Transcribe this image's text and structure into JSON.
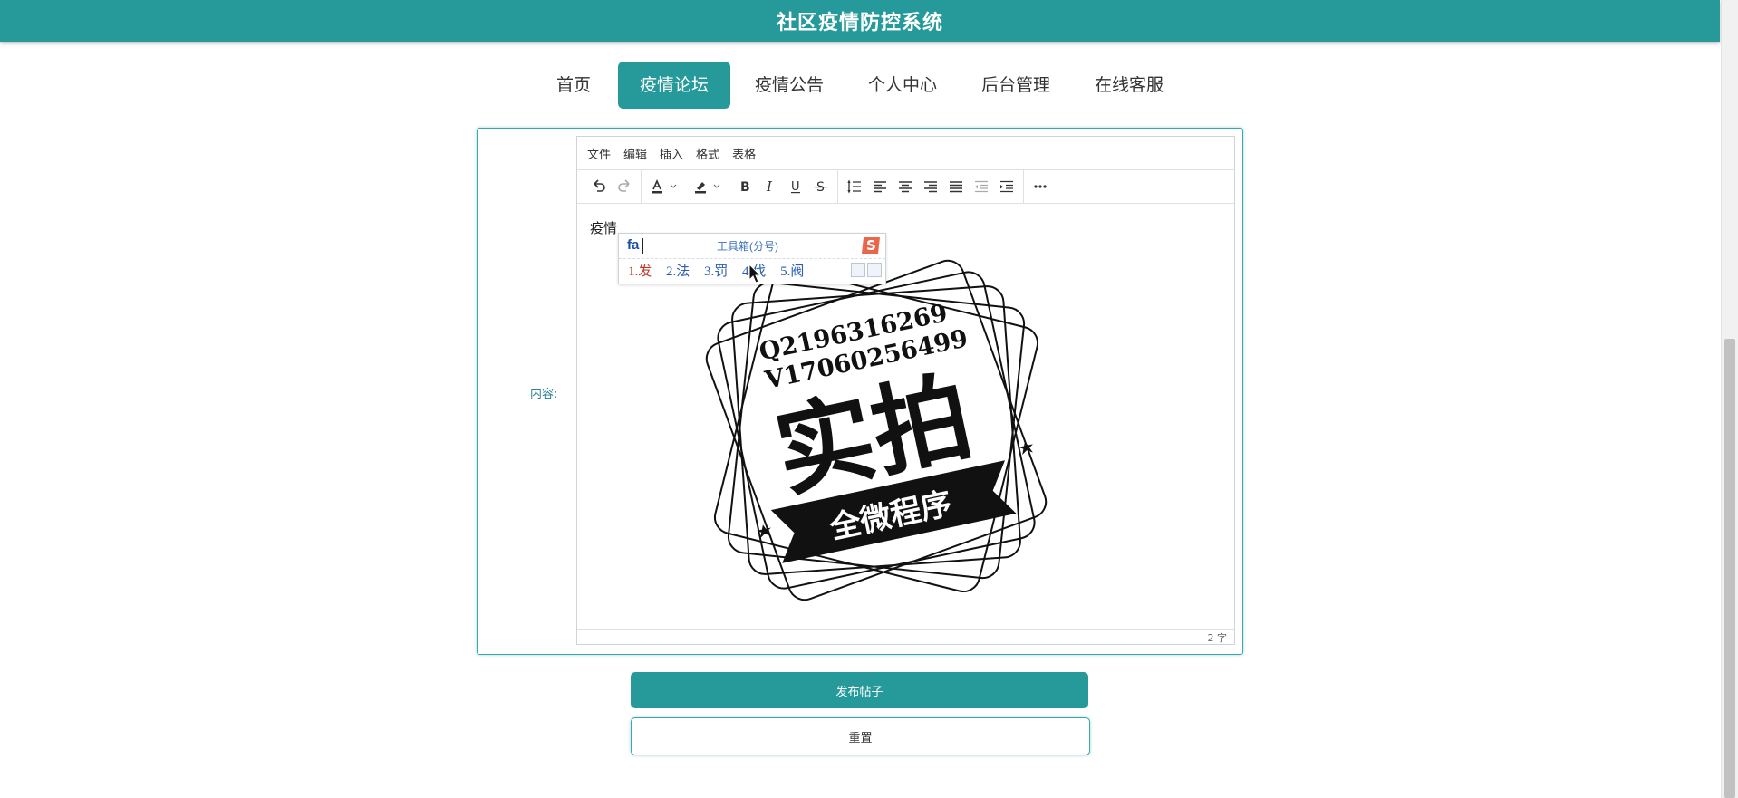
{
  "app": {
    "title": "社区疫情防控系统"
  },
  "nav": {
    "items": [
      {
        "label": "首页",
        "active": false
      },
      {
        "label": "疫情论坛",
        "active": true
      },
      {
        "label": "疫情公告",
        "active": false
      },
      {
        "label": "个人中心",
        "active": false
      },
      {
        "label": "后台管理",
        "active": false
      },
      {
        "label": "在线客服",
        "active": false
      }
    ]
  },
  "form": {
    "content_label": "内容:",
    "editor": {
      "menu": [
        "文件",
        "编辑",
        "插入",
        "格式",
        "表格"
      ],
      "text": "疫情",
      "word_count": "2 字"
    },
    "submit_label": "发布帖子",
    "reset_label": "重置"
  },
  "ime": {
    "pinyin": "fa",
    "toolbox": "工具箱(分号)",
    "candidates": [
      "1.发",
      "2.法",
      "3.罚",
      "4.伐",
      "5.阀"
    ]
  },
  "watermark": {
    "line1": "Q2196316269",
    "line2": "V17060256499",
    "big": "实拍",
    "banner": "全微程序"
  },
  "colors": {
    "brand": "#269a9a",
    "accent_border": "#3aa8b0"
  }
}
